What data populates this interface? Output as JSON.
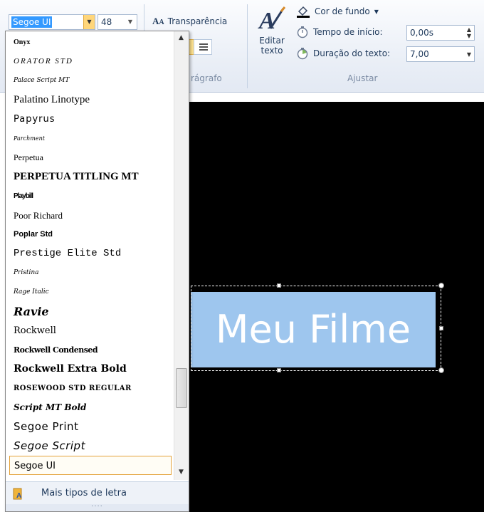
{
  "ribbon": {
    "font_name": "Segoe UI",
    "font_size": "48",
    "transparency_label": "Transparência",
    "paragraph_group_label": "rágrafo",
    "edit_text_line1": "Editar",
    "edit_text_line2": "texto",
    "bg_color_label": "Cor de fundo",
    "start_time_label": "Tempo de início:",
    "start_time_value": "0,00s",
    "duration_label": "Duração do texto:",
    "duration_value": "7,00",
    "adjust_group_label": "Ajustar"
  },
  "preview": {
    "title_text": "Meu Filme"
  },
  "font_dropdown": {
    "items": [
      "Onyx",
      "ORATOR STD",
      "Palace Script MT",
      "Palatino Linotype",
      "Papyrus",
      "Parchment",
      "Perpetua",
      "PERPETUA TITLING MT",
      "Playbill",
      "Poor Richard",
      "Poplar Std",
      "Prestige Elite Std",
      "Pristina",
      "Rage Italic",
      "Ravie",
      "Rockwell",
      "Rockwell Condensed",
      "Rockwell Extra Bold",
      "ROSEWOOD STD REGULAR",
      "Script MT Bold",
      "Segoe Print",
      "Segoe Script",
      "Segoe UI"
    ],
    "selected_index": 22,
    "more_fonts_label": "Mais tipos de letra"
  },
  "colors": {
    "accent_orange": "#e4a23a",
    "selection_blue": "#3399ff",
    "title_box_bg": "#9ec6ee"
  }
}
